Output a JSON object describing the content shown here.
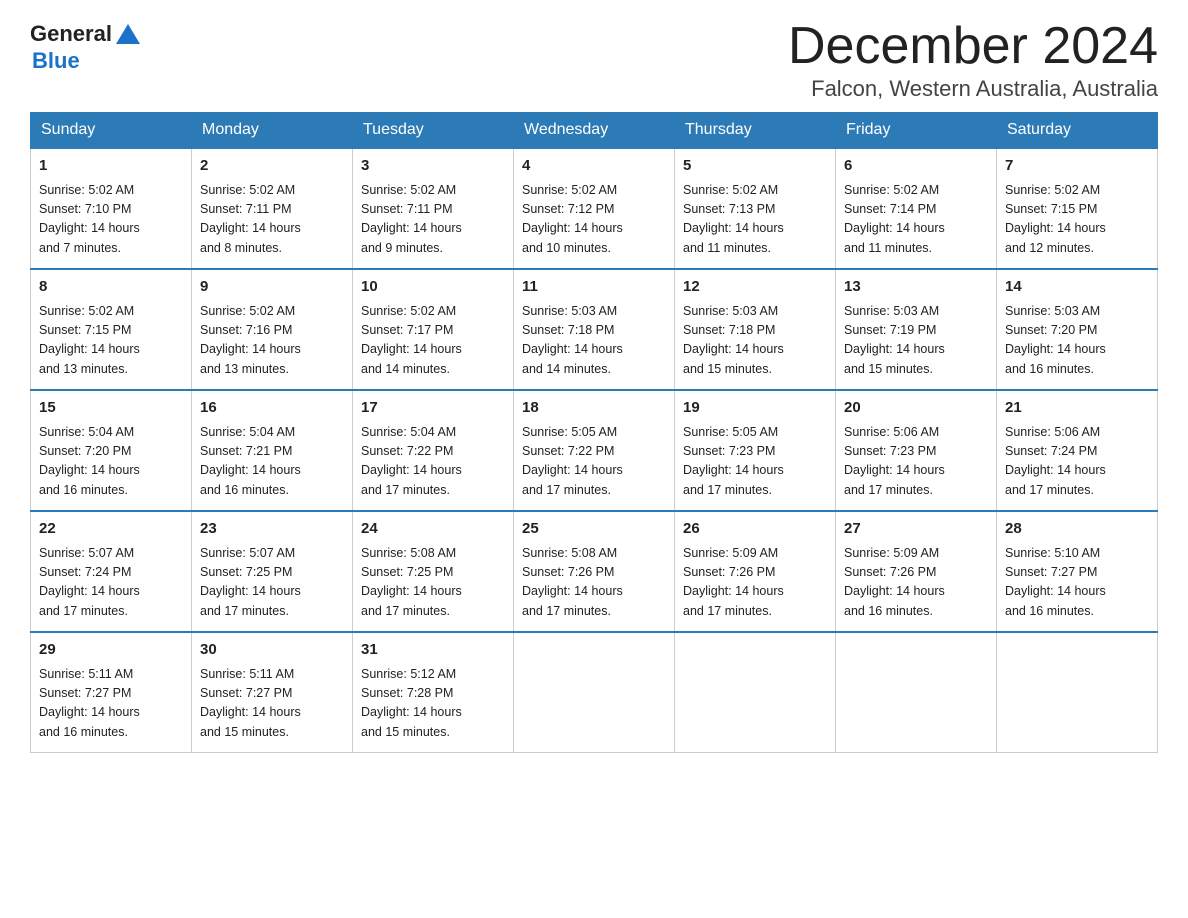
{
  "header": {
    "logo_general": "General",
    "logo_blue": "Blue",
    "month_title": "December 2024",
    "location": "Falcon, Western Australia, Australia"
  },
  "days_of_week": [
    "Sunday",
    "Monday",
    "Tuesday",
    "Wednesday",
    "Thursday",
    "Friday",
    "Saturday"
  ],
  "weeks": [
    [
      {
        "day": "1",
        "sunrise": "5:02 AM",
        "sunset": "7:10 PM",
        "daylight_hours": "14",
        "daylight_minutes": "7"
      },
      {
        "day": "2",
        "sunrise": "5:02 AM",
        "sunset": "7:11 PM",
        "daylight_hours": "14",
        "daylight_minutes": "8"
      },
      {
        "day": "3",
        "sunrise": "5:02 AM",
        "sunset": "7:11 PM",
        "daylight_hours": "14",
        "daylight_minutes": "9"
      },
      {
        "day": "4",
        "sunrise": "5:02 AM",
        "sunset": "7:12 PM",
        "daylight_hours": "14",
        "daylight_minutes": "10"
      },
      {
        "day": "5",
        "sunrise": "5:02 AM",
        "sunset": "7:13 PM",
        "daylight_hours": "14",
        "daylight_minutes": "11"
      },
      {
        "day": "6",
        "sunrise": "5:02 AM",
        "sunset": "7:14 PM",
        "daylight_hours": "14",
        "daylight_minutes": "11"
      },
      {
        "day": "7",
        "sunrise": "5:02 AM",
        "sunset": "7:15 PM",
        "daylight_hours": "14",
        "daylight_minutes": "12"
      }
    ],
    [
      {
        "day": "8",
        "sunrise": "5:02 AM",
        "sunset": "7:15 PM",
        "daylight_hours": "14",
        "daylight_minutes": "13"
      },
      {
        "day": "9",
        "sunrise": "5:02 AM",
        "sunset": "7:16 PM",
        "daylight_hours": "14",
        "daylight_minutes": "13"
      },
      {
        "day": "10",
        "sunrise": "5:02 AM",
        "sunset": "7:17 PM",
        "daylight_hours": "14",
        "daylight_minutes": "14"
      },
      {
        "day": "11",
        "sunrise": "5:03 AM",
        "sunset": "7:18 PM",
        "daylight_hours": "14",
        "daylight_minutes": "14"
      },
      {
        "day": "12",
        "sunrise": "5:03 AM",
        "sunset": "7:18 PM",
        "daylight_hours": "14",
        "daylight_minutes": "15"
      },
      {
        "day": "13",
        "sunrise": "5:03 AM",
        "sunset": "7:19 PM",
        "daylight_hours": "14",
        "daylight_minutes": "15"
      },
      {
        "day": "14",
        "sunrise": "5:03 AM",
        "sunset": "7:20 PM",
        "daylight_hours": "14",
        "daylight_minutes": "16"
      }
    ],
    [
      {
        "day": "15",
        "sunrise": "5:04 AM",
        "sunset": "7:20 PM",
        "daylight_hours": "14",
        "daylight_minutes": "16"
      },
      {
        "day": "16",
        "sunrise": "5:04 AM",
        "sunset": "7:21 PM",
        "daylight_hours": "14",
        "daylight_minutes": "16"
      },
      {
        "day": "17",
        "sunrise": "5:04 AM",
        "sunset": "7:22 PM",
        "daylight_hours": "14",
        "daylight_minutes": "17"
      },
      {
        "day": "18",
        "sunrise": "5:05 AM",
        "sunset": "7:22 PM",
        "daylight_hours": "14",
        "daylight_minutes": "17"
      },
      {
        "day": "19",
        "sunrise": "5:05 AM",
        "sunset": "7:23 PM",
        "daylight_hours": "14",
        "daylight_minutes": "17"
      },
      {
        "day": "20",
        "sunrise": "5:06 AM",
        "sunset": "7:23 PM",
        "daylight_hours": "14",
        "daylight_minutes": "17"
      },
      {
        "day": "21",
        "sunrise": "5:06 AM",
        "sunset": "7:24 PM",
        "daylight_hours": "14",
        "daylight_minutes": "17"
      }
    ],
    [
      {
        "day": "22",
        "sunrise": "5:07 AM",
        "sunset": "7:24 PM",
        "daylight_hours": "14",
        "daylight_minutes": "17"
      },
      {
        "day": "23",
        "sunrise": "5:07 AM",
        "sunset": "7:25 PM",
        "daylight_hours": "14",
        "daylight_minutes": "17"
      },
      {
        "day": "24",
        "sunrise": "5:08 AM",
        "sunset": "7:25 PM",
        "daylight_hours": "14",
        "daylight_minutes": "17"
      },
      {
        "day": "25",
        "sunrise": "5:08 AM",
        "sunset": "7:26 PM",
        "daylight_hours": "14",
        "daylight_minutes": "17"
      },
      {
        "day": "26",
        "sunrise": "5:09 AM",
        "sunset": "7:26 PM",
        "daylight_hours": "14",
        "daylight_minutes": "17"
      },
      {
        "day": "27",
        "sunrise": "5:09 AM",
        "sunset": "7:26 PM",
        "daylight_hours": "14",
        "daylight_minutes": "16"
      },
      {
        "day": "28",
        "sunrise": "5:10 AM",
        "sunset": "7:27 PM",
        "daylight_hours": "14",
        "daylight_minutes": "16"
      }
    ],
    [
      {
        "day": "29",
        "sunrise": "5:11 AM",
        "sunset": "7:27 PM",
        "daylight_hours": "14",
        "daylight_minutes": "16"
      },
      {
        "day": "30",
        "sunrise": "5:11 AM",
        "sunset": "7:27 PM",
        "daylight_hours": "14",
        "daylight_minutes": "15"
      },
      {
        "day": "31",
        "sunrise": "5:12 AM",
        "sunset": "7:28 PM",
        "daylight_hours": "14",
        "daylight_minutes": "15"
      },
      null,
      null,
      null,
      null
    ]
  ]
}
